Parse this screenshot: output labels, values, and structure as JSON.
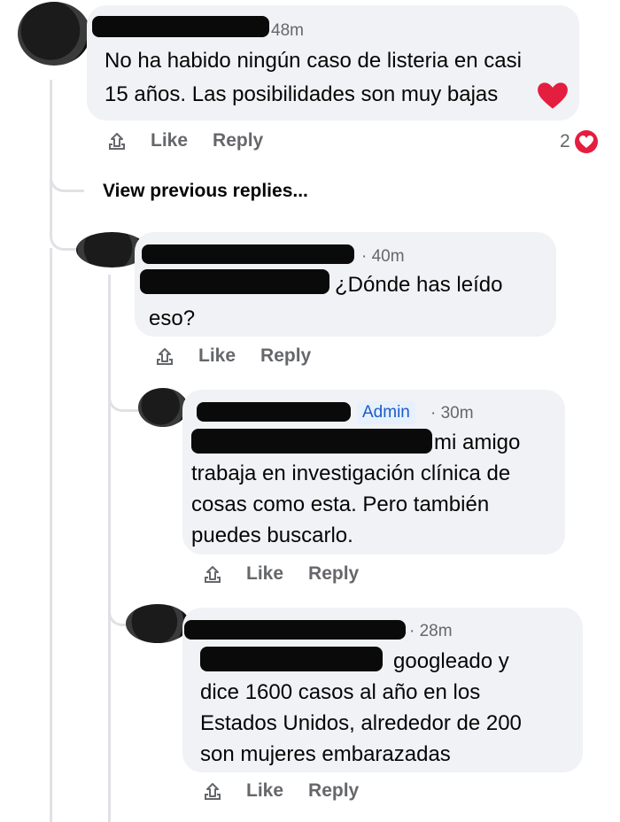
{
  "comments": [
    {
      "time": "48m",
      "text_line1": "No ha habido ningún caso de listeria en casi",
      "text_line2": "15 años. Las posibilidades son muy bajas",
      "like": "Like",
      "reply": "Reply",
      "reaction_count": "2"
    },
    {
      "time": "· 40m",
      "text_line1": "¿Dónde has leído",
      "text_line2": "eso?",
      "like": "Like",
      "reply": "Reply"
    },
    {
      "badge": "Admin",
      "time": "· 30m",
      "text_line1": "mi amigo",
      "text_line2": "trabaja en investigación clínica de",
      "text_line3": "cosas como esta. Pero también",
      "text_line4": "puedes buscarlo.",
      "like": "Like",
      "reply": "Reply"
    },
    {
      "time": "· 28m",
      "text_line1": "googleado y",
      "text_line2": "dice 1600 casos al año en los",
      "text_line3": "Estados Unidos, alrededor de 200",
      "text_line4": "son mujeres embarazadas",
      "like": "Like",
      "reply": "Reply"
    }
  ],
  "view_previous": "View previous replies...",
  "icons": {
    "reaction": "reaction-icon",
    "heart": "heart-icon"
  },
  "colors": {
    "bubble": "#f0f2f5",
    "meta": "#65676b",
    "heart": "#e41e3f",
    "admin_text": "#1b5cc9"
  }
}
